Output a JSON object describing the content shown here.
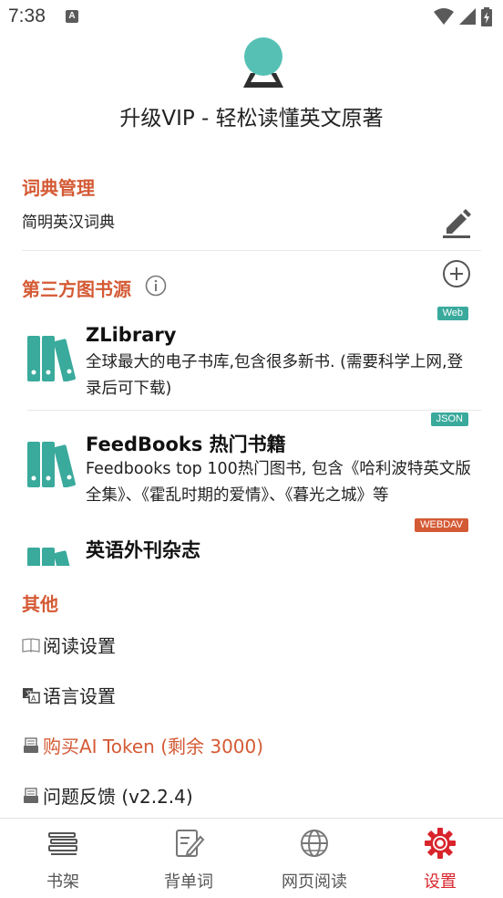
{
  "status_bar": {
    "time": "7:38",
    "notification_letter": "A"
  },
  "header": {
    "title": "升级VIP - 轻松读懂英文原著"
  },
  "dictionary": {
    "title": "词典管理",
    "current": "简明英汉词典"
  },
  "sources": {
    "title": "第三方图书源",
    "items": [
      {
        "tag": "Web",
        "tag_color": "#3aaa9c",
        "name": "ZLibrary",
        "desc": "全球最大的电子书库,包含很多新书. (需要科学上网,登录后可下载)"
      },
      {
        "tag": "JSON",
        "tag_color": "#3aaa9c",
        "name": "FeedBooks 热门书籍",
        "desc": "Feedbooks top 100热门图书, 包含《哈利波特英文版全集》、《霍乱时期的爱情》、《暮光之城》等"
      },
      {
        "tag": "WEBDAV",
        "tag_color": "#d45a35",
        "name": "英语外刊杂志",
        "desc": ""
      }
    ]
  },
  "other": {
    "title": "其他",
    "items": [
      {
        "label": "阅读设置"
      },
      {
        "label": "语言设置"
      },
      {
        "label": "购买AI Token (剩余 3000)"
      },
      {
        "label": "问题反馈 (v2.2.4)"
      }
    ]
  },
  "nav": {
    "items": [
      {
        "label": "书架"
      },
      {
        "label": "背单词"
      },
      {
        "label": "网页阅读"
      },
      {
        "label": "设置"
      }
    ],
    "active_index": 3
  },
  "colors": {
    "accent": "#d45a35",
    "teal": "#3aaa9c",
    "nav_active": "#d8252c"
  }
}
